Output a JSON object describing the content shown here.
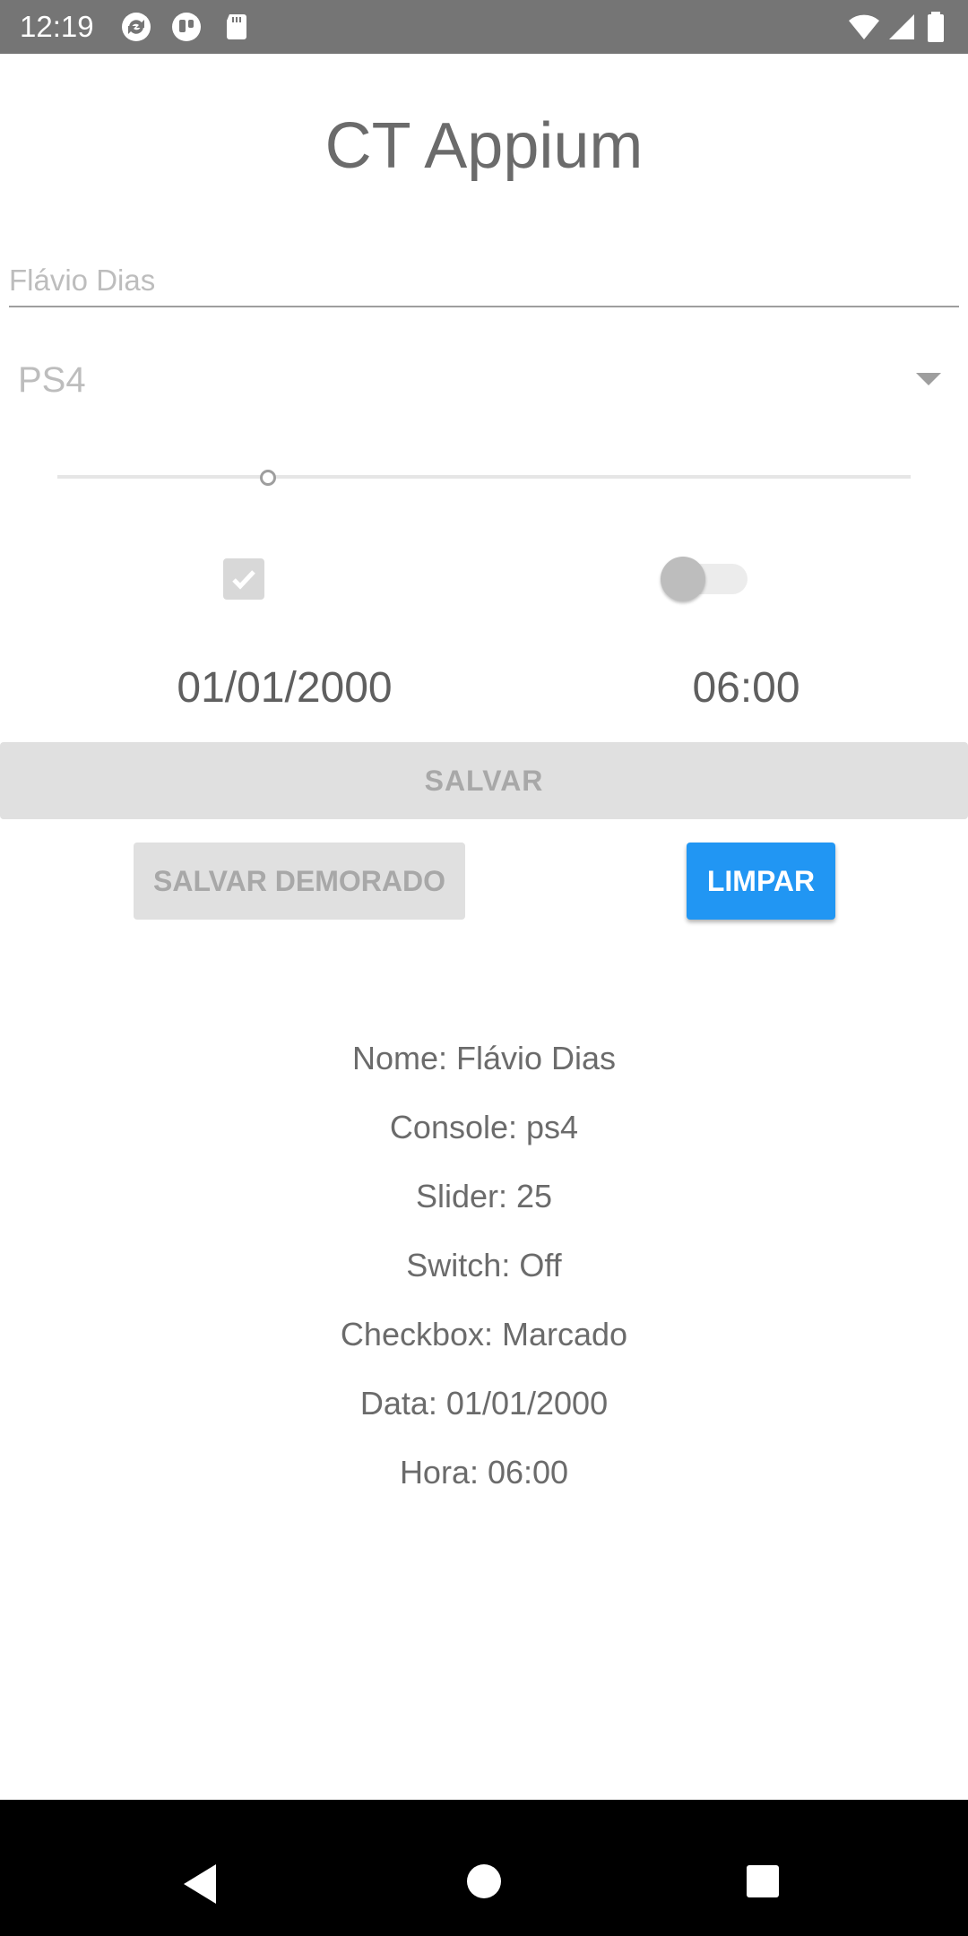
{
  "status_bar": {
    "time": "12:19",
    "icons": [
      "sync-icon",
      "pocket-icon",
      "sd-card-icon",
      "wifi-icon",
      "signal-icon",
      "battery-icon"
    ]
  },
  "app": {
    "title": "CT Appium",
    "name_input": {
      "value": "Flávio Dias"
    },
    "console_select": {
      "value": "PS4"
    },
    "slider": {
      "value_fraction": 0.25
    },
    "checkbox": {
      "checked": true
    },
    "switch": {
      "on": false
    },
    "date": "01/01/2000",
    "time": "06:00",
    "buttons": {
      "save": "SALVAR",
      "save_delayed": "SALVAR DEMORADO",
      "clear": "LIMPAR"
    },
    "results": [
      "Nome: Flávio Dias",
      "Console: ps4",
      "Slider: 25",
      "Switch: Off",
      "Checkbox: Marcado",
      "Data: 01/01/2000",
      "Hora: 06:00"
    ]
  },
  "colors": {
    "status_bar": "#757575",
    "accent": "#2196f3",
    "disabled_button": "#e0e0e0"
  },
  "nav_bar": {
    "buttons": [
      "back-icon",
      "home-icon",
      "recents-icon"
    ]
  }
}
